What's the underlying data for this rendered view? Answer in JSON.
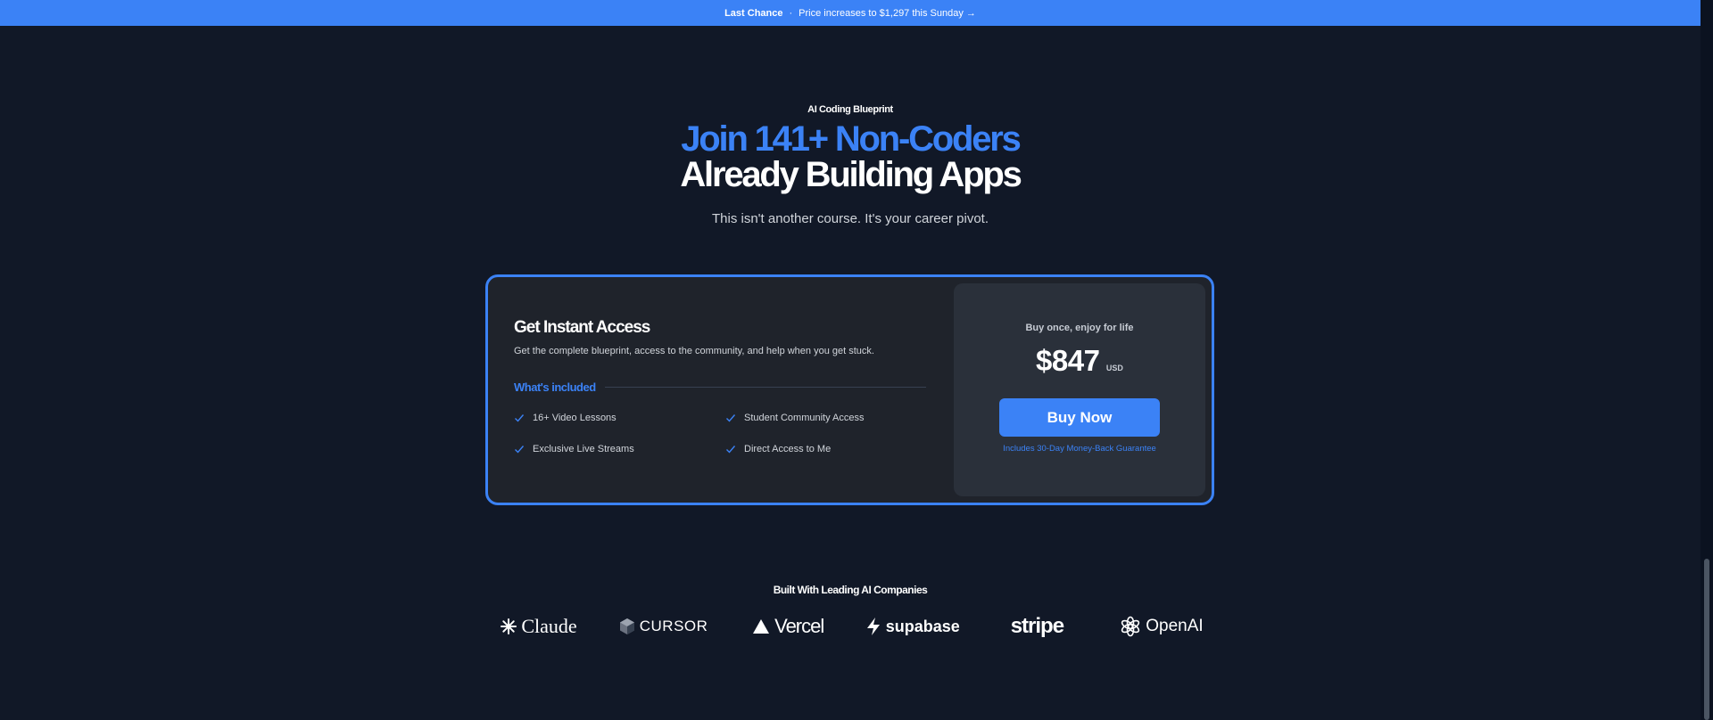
{
  "banner": {
    "strong": "Last Chance",
    "separator": "·",
    "text": "Price increases to $1,297 this Sunday →"
  },
  "hero": {
    "eyebrow": "AI Coding Blueprint",
    "headline_line1": "Join 141+ Non-Coders",
    "headline_line2": "Already Building Apps",
    "subhead": "This isn't another course. It's your career pivot."
  },
  "offer": {
    "title": "Get Instant Access",
    "description": "Get the complete blueprint, access to the community, and help when you get stuck.",
    "included_label": "What's included",
    "features": [
      "16+ Video Lessons",
      "Student Community Access",
      "Exclusive Live Streams",
      "Direct Access to Me"
    ],
    "tagline": "Buy once, enjoy for life",
    "price": "$847",
    "currency": "USD",
    "button": "Buy Now",
    "guarantee": "Includes 30-Day Money-Back Guarantee"
  },
  "companies": {
    "title": "Built With Leading AI Companies",
    "logos": [
      {
        "name": "Claude",
        "icon": "claude-icon"
      },
      {
        "name": "CURSOR",
        "icon": "cursor-icon"
      },
      {
        "name": "Vercel",
        "icon": "vercel-icon"
      },
      {
        "name": "supabase",
        "icon": "supabase-icon"
      },
      {
        "name": "stripe",
        "icon": ""
      },
      {
        "name": "OpenAI",
        "icon": "openai-icon"
      }
    ]
  },
  "colors": {
    "background": "#111827",
    "accent": "#3b82f6",
    "card": "#1f232b",
    "price_panel": "#2a303a"
  }
}
